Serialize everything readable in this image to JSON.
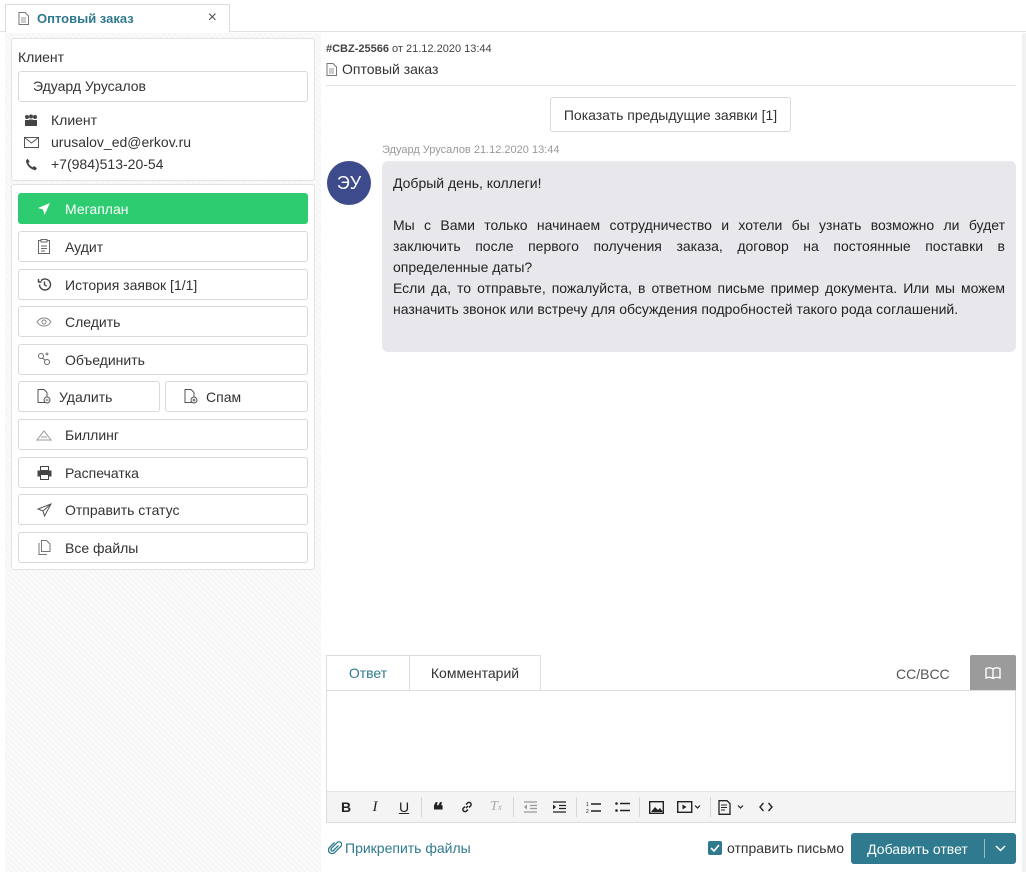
{
  "tab": {
    "label": "Оптовый заказ"
  },
  "client": {
    "section_title": "Клиент",
    "name": "Эдуард Урусалов",
    "type": "Клиент",
    "email": "urusalov_ed@erkov.ru",
    "phone": "+7(984)513-20-54"
  },
  "actions": {
    "megaplan": "Мегаплан",
    "audit": "Аудит",
    "history": "История заявок [1/1]",
    "follow": "Следить",
    "merge": "Объединить",
    "delete": "Удалить",
    "spam": "Спам",
    "billing": "Биллинг",
    "print": "Распечатка",
    "send_status": "Отправить статус",
    "all_files": "Все файлы"
  },
  "ticket": {
    "id": "#CBZ-25566",
    "date_text": "от 21.12.2020 13:44",
    "title": "Оптовый заказ",
    "prev_button": "Показать предыдущие заявки [1]"
  },
  "message": {
    "meta": "Эдуард Урусалов 21.12.2020 13:44",
    "avatar_initials": "ЭУ",
    "greeting": "Добрый день, коллеги!",
    "para1": "Мы с Вами только начинаем сотрудничество и хотели бы узнать возможно ли будет заключить после первого получения заказа, договор на постоянные поставки в определенные даты?",
    "para2": "Если да, то отправьте, пожалуйста, в ответном письме пример документа. Или мы можем назначить звонок или встречу для обсуждения подробностей такого рода соглашений."
  },
  "reply": {
    "tab_reply": "Ответ",
    "tab_comment": "Комментарий",
    "cc": "CC/BCC",
    "attach": "Прикрепить файлы",
    "send_email": "отправить письмо",
    "submit": "Добавить ответ"
  },
  "colors": {
    "accent": "#2f7a8e",
    "green": "#2ecc71",
    "avatar": "#3d4a8c",
    "bubble": "#e8e8ec"
  }
}
